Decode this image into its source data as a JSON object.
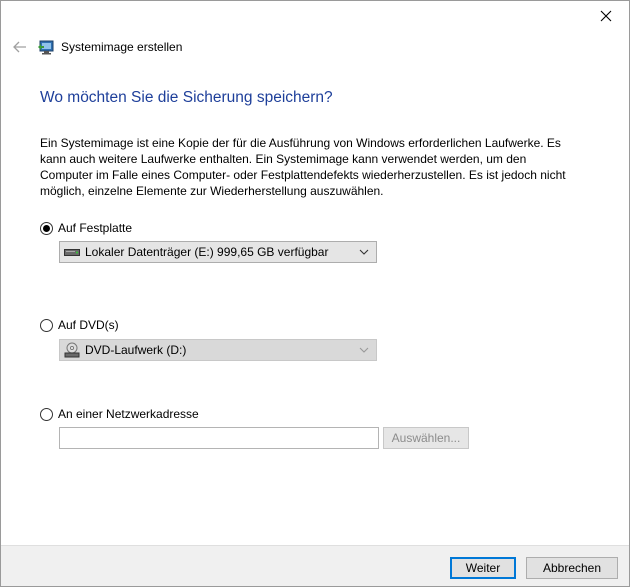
{
  "window": {
    "title": "Systemimage erstellen"
  },
  "heading": "Wo möchten Sie die Sicherung speichern?",
  "description": "Ein Systemimage ist eine Kopie der für die Ausführung von Windows erforderlichen Laufwerke. Es kann auch weitere Laufwerke enthalten. Ein Systemimage kann verwendet werden, um den Computer im Falle eines Computer- oder Festplattendefekts wiederherzustellen. Es ist jedoch nicht möglich, einzelne Elemente zur Wiederherstellung auszuwählen.",
  "options": {
    "harddisk": {
      "label": "Auf Festplatte",
      "checked": true,
      "selected_drive": "Lokaler Datenträger (E:)  999,65 GB verfügbar"
    },
    "dvd": {
      "label": "Auf DVD(s)",
      "checked": false,
      "selected_drive": "DVD-Laufwerk (D:)"
    },
    "network": {
      "label": "An einer Netzwerkadresse",
      "checked": false,
      "input_value": "",
      "browse_label": "Auswählen..."
    }
  },
  "footer": {
    "next_label": "Weiter",
    "cancel_label": "Abbrechen"
  },
  "colors": {
    "heading": "#1e3f9a",
    "accent": "#0078d7"
  }
}
